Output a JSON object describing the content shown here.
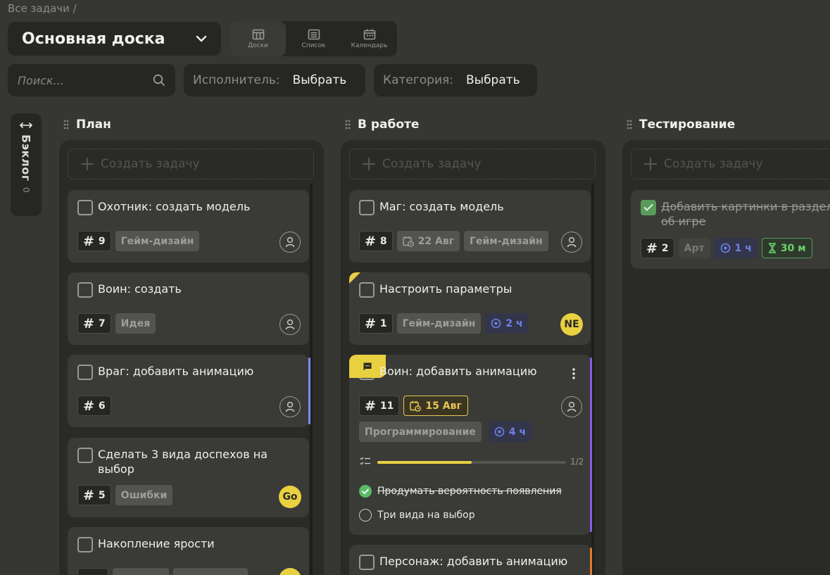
{
  "breadcrumb": "Все задачи /",
  "board": {
    "title": "Основная доска"
  },
  "views": [
    {
      "label": "Доски",
      "icon": "board-icon",
      "active": true
    },
    {
      "label": "Список",
      "icon": "list-icon"
    },
    {
      "label": "Календарь",
      "icon": "calendar-icon"
    }
  ],
  "search": {
    "placeholder": "Поиск..."
  },
  "filters": {
    "assignee": {
      "label": "Исполнитель:",
      "value": "Выбрать"
    },
    "category": {
      "label": "Категория:",
      "value": "Выбрать"
    }
  },
  "backlog": {
    "label": "Бэклог",
    "count": "0"
  },
  "create_label": "Создать задачу",
  "colors": {
    "accent": "#e8d040",
    "purple": "#8a5ce6",
    "blue": "#6a82e6",
    "orange": "#e07b2e",
    "green": "#5aba6a"
  },
  "columns": [
    {
      "title": "План",
      "cards": [
        {
          "title": "Охотник: создать модель",
          "num": "9",
          "category": "Гейм-дизайн"
        },
        {
          "title": "Воин: создать",
          "num": "7",
          "category": "Идея"
        },
        {
          "title": "Враг: добавить анимацию",
          "num": "6"
        },
        {
          "title": "Сделать 3 вида доспехов на выбор",
          "num": "5",
          "category": "Ошибки",
          "assignee": "Go"
        },
        {
          "title": "Накопление ярости"
        }
      ]
    },
    {
      "title": "В работе",
      "cards": [
        {
          "title": "Маг: создать модель",
          "num": "8",
          "date": "22 Авг",
          "category": "Гейм-дизайн"
        },
        {
          "title": "Настроить параметры",
          "num": "1",
          "category": "Гейм-дизайн",
          "estimate": "2 ч",
          "assignee": "NE"
        },
        {
          "title": "Воин: добавить анимацию",
          "num": "11",
          "date": "15 Авг",
          "category": "Программирование",
          "estimate": "4 ч",
          "progress": 0.5,
          "progress_text": "1/2",
          "subtasks": [
            {
              "title": "Продумать вероятность появления",
              "done": true
            },
            {
              "title": "Три вида на выбор",
              "done": false
            }
          ]
        },
        {
          "title": "Персонаж: добавить анимацию"
        }
      ]
    },
    {
      "title": "Тестирование",
      "cards": [
        {
          "title": "Добавить картинки в раздел об игре",
          "num": "2",
          "category": "Арт",
          "estimate": "1 ч",
          "timer": "30 м",
          "done": true
        }
      ]
    }
  ]
}
